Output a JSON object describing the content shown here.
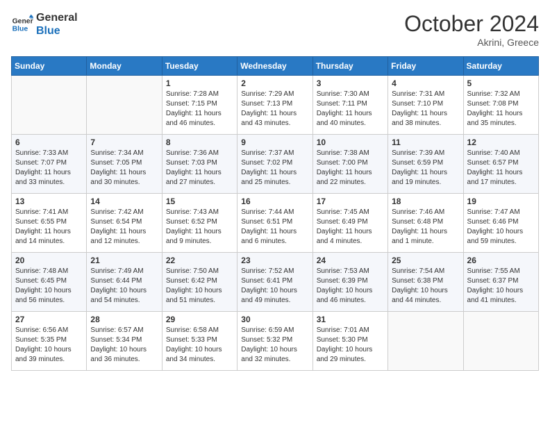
{
  "header": {
    "logo_line1": "General",
    "logo_line2": "Blue",
    "month_year": "October 2024",
    "location": "Akrini, Greece"
  },
  "weekdays": [
    "Sunday",
    "Monday",
    "Tuesday",
    "Wednesday",
    "Thursday",
    "Friday",
    "Saturday"
  ],
  "weeks": [
    [
      {
        "day": null
      },
      {
        "day": null
      },
      {
        "day": "1",
        "sunrise": "Sunrise: 7:28 AM",
        "sunset": "Sunset: 7:15 PM",
        "daylight": "Daylight: 11 hours and 46 minutes."
      },
      {
        "day": "2",
        "sunrise": "Sunrise: 7:29 AM",
        "sunset": "Sunset: 7:13 PM",
        "daylight": "Daylight: 11 hours and 43 minutes."
      },
      {
        "day": "3",
        "sunrise": "Sunrise: 7:30 AM",
        "sunset": "Sunset: 7:11 PM",
        "daylight": "Daylight: 11 hours and 40 minutes."
      },
      {
        "day": "4",
        "sunrise": "Sunrise: 7:31 AM",
        "sunset": "Sunset: 7:10 PM",
        "daylight": "Daylight: 11 hours and 38 minutes."
      },
      {
        "day": "5",
        "sunrise": "Sunrise: 7:32 AM",
        "sunset": "Sunset: 7:08 PM",
        "daylight": "Daylight: 11 hours and 35 minutes."
      }
    ],
    [
      {
        "day": "6",
        "sunrise": "Sunrise: 7:33 AM",
        "sunset": "Sunset: 7:07 PM",
        "daylight": "Daylight: 11 hours and 33 minutes."
      },
      {
        "day": "7",
        "sunrise": "Sunrise: 7:34 AM",
        "sunset": "Sunset: 7:05 PM",
        "daylight": "Daylight: 11 hours and 30 minutes."
      },
      {
        "day": "8",
        "sunrise": "Sunrise: 7:36 AM",
        "sunset": "Sunset: 7:03 PM",
        "daylight": "Daylight: 11 hours and 27 minutes."
      },
      {
        "day": "9",
        "sunrise": "Sunrise: 7:37 AM",
        "sunset": "Sunset: 7:02 PM",
        "daylight": "Daylight: 11 hours and 25 minutes."
      },
      {
        "day": "10",
        "sunrise": "Sunrise: 7:38 AM",
        "sunset": "Sunset: 7:00 PM",
        "daylight": "Daylight: 11 hours and 22 minutes."
      },
      {
        "day": "11",
        "sunrise": "Sunrise: 7:39 AM",
        "sunset": "Sunset: 6:59 PM",
        "daylight": "Daylight: 11 hours and 19 minutes."
      },
      {
        "day": "12",
        "sunrise": "Sunrise: 7:40 AM",
        "sunset": "Sunset: 6:57 PM",
        "daylight": "Daylight: 11 hours and 17 minutes."
      }
    ],
    [
      {
        "day": "13",
        "sunrise": "Sunrise: 7:41 AM",
        "sunset": "Sunset: 6:55 PM",
        "daylight": "Daylight: 11 hours and 14 minutes."
      },
      {
        "day": "14",
        "sunrise": "Sunrise: 7:42 AM",
        "sunset": "Sunset: 6:54 PM",
        "daylight": "Daylight: 11 hours and 12 minutes."
      },
      {
        "day": "15",
        "sunrise": "Sunrise: 7:43 AM",
        "sunset": "Sunset: 6:52 PM",
        "daylight": "Daylight: 11 hours and 9 minutes."
      },
      {
        "day": "16",
        "sunrise": "Sunrise: 7:44 AM",
        "sunset": "Sunset: 6:51 PM",
        "daylight": "Daylight: 11 hours and 6 minutes."
      },
      {
        "day": "17",
        "sunrise": "Sunrise: 7:45 AM",
        "sunset": "Sunset: 6:49 PM",
        "daylight": "Daylight: 11 hours and 4 minutes."
      },
      {
        "day": "18",
        "sunrise": "Sunrise: 7:46 AM",
        "sunset": "Sunset: 6:48 PM",
        "daylight": "Daylight: 11 hours and 1 minute."
      },
      {
        "day": "19",
        "sunrise": "Sunrise: 7:47 AM",
        "sunset": "Sunset: 6:46 PM",
        "daylight": "Daylight: 10 hours and 59 minutes."
      }
    ],
    [
      {
        "day": "20",
        "sunrise": "Sunrise: 7:48 AM",
        "sunset": "Sunset: 6:45 PM",
        "daylight": "Daylight: 10 hours and 56 minutes."
      },
      {
        "day": "21",
        "sunrise": "Sunrise: 7:49 AM",
        "sunset": "Sunset: 6:44 PM",
        "daylight": "Daylight: 10 hours and 54 minutes."
      },
      {
        "day": "22",
        "sunrise": "Sunrise: 7:50 AM",
        "sunset": "Sunset: 6:42 PM",
        "daylight": "Daylight: 10 hours and 51 minutes."
      },
      {
        "day": "23",
        "sunrise": "Sunrise: 7:52 AM",
        "sunset": "Sunset: 6:41 PM",
        "daylight": "Daylight: 10 hours and 49 minutes."
      },
      {
        "day": "24",
        "sunrise": "Sunrise: 7:53 AM",
        "sunset": "Sunset: 6:39 PM",
        "daylight": "Daylight: 10 hours and 46 minutes."
      },
      {
        "day": "25",
        "sunrise": "Sunrise: 7:54 AM",
        "sunset": "Sunset: 6:38 PM",
        "daylight": "Daylight: 10 hours and 44 minutes."
      },
      {
        "day": "26",
        "sunrise": "Sunrise: 7:55 AM",
        "sunset": "Sunset: 6:37 PM",
        "daylight": "Daylight: 10 hours and 41 minutes."
      }
    ],
    [
      {
        "day": "27",
        "sunrise": "Sunrise: 6:56 AM",
        "sunset": "Sunset: 5:35 PM",
        "daylight": "Daylight: 10 hours and 39 minutes."
      },
      {
        "day": "28",
        "sunrise": "Sunrise: 6:57 AM",
        "sunset": "Sunset: 5:34 PM",
        "daylight": "Daylight: 10 hours and 36 minutes."
      },
      {
        "day": "29",
        "sunrise": "Sunrise: 6:58 AM",
        "sunset": "Sunset: 5:33 PM",
        "daylight": "Daylight: 10 hours and 34 minutes."
      },
      {
        "day": "30",
        "sunrise": "Sunrise: 6:59 AM",
        "sunset": "Sunset: 5:32 PM",
        "daylight": "Daylight: 10 hours and 32 minutes."
      },
      {
        "day": "31",
        "sunrise": "Sunrise: 7:01 AM",
        "sunset": "Sunset: 5:30 PM",
        "daylight": "Daylight: 10 hours and 29 minutes."
      },
      {
        "day": null
      },
      {
        "day": null
      }
    ]
  ]
}
